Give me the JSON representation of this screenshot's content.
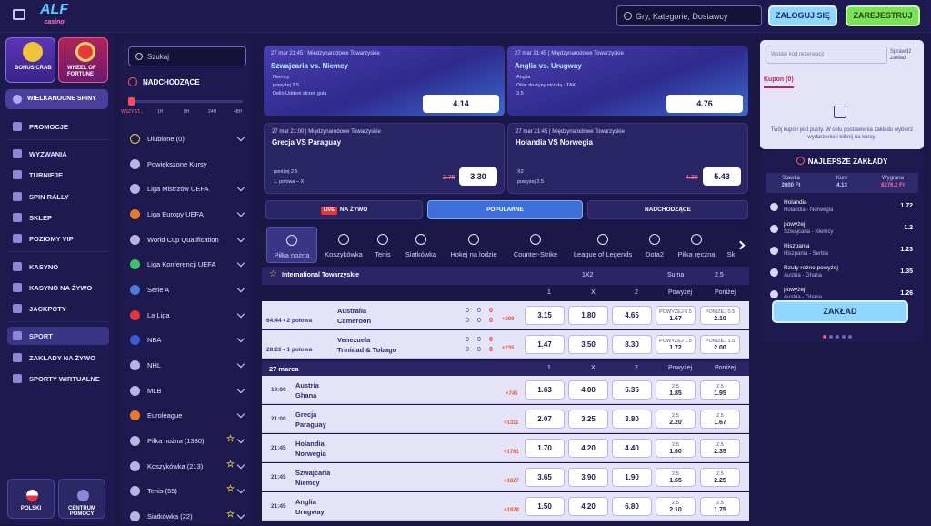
{
  "header": {
    "logo": "ALF",
    "logo_sub": "casino",
    "search_placeholder": "Gry, Kategorie, Dostawcy",
    "login": "ZALOGUJ SIĘ",
    "register": "ZAREJESTRUJ"
  },
  "nav": {
    "promo1": "BONUS CRAB",
    "promo2": "WHEEL OF FORTUNE",
    "spins": "WIELKANOCNE SPINY",
    "items": [
      "PROMOCJE",
      "WYZWANIA",
      "TURNIEJE",
      "SPIN RALLY",
      "SKLEP",
      "POZIOMY VIP",
      "KASYNO",
      "KASYNO NA ŻYWO",
      "JACKPOTY",
      "SPORT",
      "ZAKŁADY NA ŻYWO",
      "SPORTY WIRTUALNE"
    ],
    "lang": "POLSKI",
    "help": "CENTRUM POMOCY",
    "help_l2": "POMOCY"
  },
  "leagues": {
    "search": "Szukaj",
    "upcoming": "NADCHODZĄCE",
    "slider_labels": [
      "WSZYST...",
      "1H",
      "8H",
      "24H",
      "48H"
    ],
    "items": [
      "Ulubione (0)",
      "Powiększone Kursy",
      "Liga Mistrzów UEFA",
      "Liga Europy UEFA",
      "World Cup Qualification",
      "Liga Konferencji UEFA",
      "Serie A",
      "La Liga",
      "NBA",
      "NHL",
      "MLB",
      "Euroleague",
      "Piłka nożna (1380)",
      "Koszykówka (213)",
      "Tenis (55)",
      "Siatkówka (22)"
    ]
  },
  "featured": [
    {
      "meta": "27 mar 21:45 | Międzynarodowe Towarzyskie",
      "title": "Szwajcaria vs. Niemcy",
      "lines": [
        "Niemcy",
        "powyżej 2.5",
        "Dello Uddeni strzeli gola"
      ],
      "odd": "4.14"
    },
    {
      "meta": "27 mar 21:45 | Międzynarodowe Towarzyskie",
      "title": "Anglia vs. Urugway",
      "lines": [
        "Anglia",
        "Obie drużyny strzelą - TAK",
        "3.5"
      ],
      "odd": "4.76"
    },
    {
      "meta": "27 mar 21:00 | Międzynarodowe Towarzyskie",
      "title": "Grecja VS Paraguay",
      "lines": [
        "poniżej 2.5",
        "1. połowa – X"
      ],
      "old": "2.75",
      "odd": "3.30"
    },
    {
      "meta": "27 mar 21:45 | Międzynarodowe Towarzyskie",
      "title": "Holandia VS Norwegia",
      "lines": [
        "X2",
        "powyżej 2.5"
      ],
      "old": "4.38",
      "odd": "5.43"
    }
  ],
  "tabs": {
    "live_badge": "LIVE",
    "live": "NA ŻYWO",
    "popular": "POPULARNE",
    "upcoming": "NADCHODZĄCE"
  },
  "sports": [
    "Piłka nożna",
    "Koszykówka",
    "Tenis",
    "Siatkówka",
    "Hokej na lodzie",
    "Counter-Strike",
    "League of Legends",
    "Dota2",
    "Piłka ręczna",
    "Sk"
  ],
  "league_head": {
    "name": "International Towarzyskie",
    "market1": "1X2",
    "market2": "Suma",
    "market3": "2.5"
  },
  "cols": [
    "1",
    "X",
    "2",
    "Powyżej",
    "Poniżej"
  ],
  "live_rows": [
    {
      "time": "64:44 • 2 połowa",
      "t1": "Australia",
      "t2": "Cameroon",
      "s1": [
        "0",
        "0",
        "0"
      ],
      "s2": [
        "0",
        "0",
        "0"
      ],
      "plus": "+209",
      "o": [
        "3.15",
        "1.80",
        "4.65"
      ],
      "ov": [
        "POWYŻEJ 0.5",
        "1.67"
      ],
      "un": [
        "PONIŻEJ 0.5",
        "2.10"
      ]
    },
    {
      "time": "28:26 • 1 połowa",
      "t1": "Venezuela",
      "t2": "Trinidad & Tobago",
      "s1": [
        "0",
        "0",
        "0"
      ],
      "s2": [
        "0",
        "0",
        "0"
      ],
      "plus": "+235",
      "o": [
        "1.47",
        "3.50",
        "8.30"
      ],
      "ov": [
        "POWYŻEJ 1.5",
        "1.72"
      ],
      "un": [
        "PONIŻEJ 1.5",
        "2.00"
      ]
    }
  ],
  "day": "27 marca",
  "rows": [
    {
      "time": "19:00",
      "t1": "Austria",
      "t2": "Ghana",
      "plus": "+745",
      "o": [
        "1.63",
        "4.00",
        "5.35"
      ],
      "line": "2.5",
      "ov": "1.85",
      "un": "1.95"
    },
    {
      "time": "21:00",
      "t1": "Grecja",
      "t2": "Paraguay",
      "plus": "+1311",
      "o": [
        "2.07",
        "3.25",
        "3.80"
      ],
      "line": "2.5",
      "ov": "2.20",
      "un": "1.67"
    },
    {
      "time": "21:45",
      "t1": "Holandia",
      "t2": "Norwegia",
      "plus": "+1761",
      "o": [
        "1.70",
        "4.20",
        "4.40"
      ],
      "line": "2.5",
      "ov": "1.60",
      "un": "2.35"
    },
    {
      "time": "21:45",
      "t1": "Szwajcaria",
      "t2": "Niemcy",
      "plus": "+1827",
      "o": [
        "3.65",
        "3.90",
        "1.90"
      ],
      "line": "2.5",
      "ov": "1.65",
      "un": "2.25"
    },
    {
      "time": "21:45",
      "t1": "Anglia",
      "t2": "Urugway",
      "plus": "+1829",
      "o": [
        "1.50",
        "4.20",
        "6.80"
      ],
      "line": "2.5",
      "ov": "2.10",
      "un": "1.75"
    }
  ],
  "coupon": {
    "placeholder": "Wstaw kod rezerwacji",
    "check": "Sprawdź zakład",
    "tab": "Kupon (0)",
    "empty": "Twój kupon jest pusty. W celu postawienia zakładu wybierz wydarzenie i kliknij na kursy."
  },
  "best": {
    "title": "NAJLEPSZE ZAKŁADY",
    "stake_l": "Stawka",
    "stake_v": "2000 Ft",
    "odds_l": "Kurs",
    "odds_v": "4.13",
    "win_l": "Wygrana",
    "win_v": "8276.2 Ft",
    "picks": [
      {
        "a": "Holandia",
        "b": "Holandia - Norwegia",
        "o": "1.72"
      },
      {
        "a": "powyżej",
        "b": "Szwajcaria - Niemcy",
        "o": "1.2"
      },
      {
        "a": "Hiszpania",
        "b": "Hiszpania - Serbia",
        "o": "1.23"
      },
      {
        "a": "Rzuty rożne powyżej",
        "b": "Austria - Ghana",
        "o": "1.35"
      },
      {
        "a": "powyżej",
        "b": "Austria - Ghana",
        "o": "1.26"
      }
    ],
    "button": "ZAKŁAD"
  }
}
